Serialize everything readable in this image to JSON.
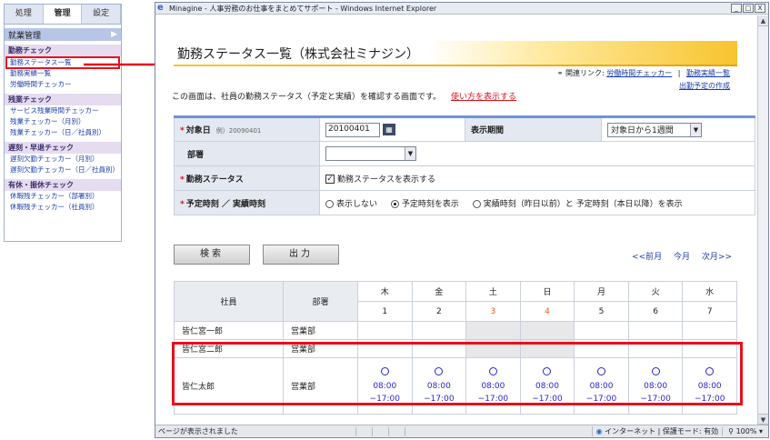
{
  "sidebar": {
    "tabs": [
      "処理",
      "管理",
      "設定"
    ],
    "active_tab": "管理",
    "section_title": "就業管理",
    "groups": [
      {
        "title": "勤務チェック",
        "links": [
          "勤務ステータス一覧",
          "勤務実績一覧",
          "労働時間チェッカー"
        ]
      },
      {
        "title": "残業チェック",
        "links": [
          "サービス残業時間チェッカー",
          "残業チェッカー（月別）",
          "残業チェッカー（日／社員別）"
        ]
      },
      {
        "title": "遅刻・早退チェック",
        "links": [
          "遅刻欠勤チェッカー（月別）",
          "遅刻欠勤チェッカー（日／社員別）"
        ]
      },
      {
        "title": "有休・振休チェック",
        "links": [
          "休暇残チェッカー（部署別）",
          "休暇残チェッカー（社員別）"
        ]
      }
    ]
  },
  "window": {
    "title": "Minagine - 人事労務のお仕事をまとめてサポート - Windows Internet Explorer",
    "min_btn": "_",
    "max_btn": "□",
    "close_btn": "X"
  },
  "page": {
    "title": "勤務ステータス一覧（株式会社ミナジン）",
    "related_label": "関連リンク:",
    "related_links": [
      "労働時間チェッカー",
      "勤務実績一覧",
      "出勤予定の作成"
    ],
    "related_sep": "|",
    "intro": "この画面は、社員の勤務ステータス（予定と実績）を確認する画面です。",
    "usage_link": "使い方を表示する"
  },
  "form": {
    "target_date_label": "対象日",
    "target_date_example": "例）20090401",
    "target_date_value": "20100401",
    "period_label": "表示期間",
    "period_value": "対象日から1週間",
    "dept_label": "部署",
    "dept_value": "",
    "status_label": "勤務ステータス",
    "status_checkbox_label": "勤務ステータスを表示する",
    "time_label": "予定時刻 ／ 実績時刻",
    "time_options": [
      "表示しない",
      "予定時刻を表示",
      "実績時刻（昨日以前）と 予定時刻（本日以降）を表示"
    ],
    "time_selected": 1,
    "req_mark": "*",
    "cal_icon": "▦",
    "dropdown_icon": "▼",
    "check_mark": "✓"
  },
  "buttons": {
    "search": "検索",
    "output": "出力"
  },
  "period_nav": {
    "prev": "<<前月",
    "current": "今月",
    "next": "次月>>"
  },
  "schedule": {
    "col_employee": "社員",
    "col_dept": "部署",
    "days": [
      {
        "weekday": "木",
        "date": "1",
        "weekend": false
      },
      {
        "weekday": "金",
        "date": "2",
        "weekend": false
      },
      {
        "weekday": "土",
        "date": "3",
        "weekend": true
      },
      {
        "weekday": "日",
        "date": "4",
        "weekend": true
      },
      {
        "weekday": "月",
        "date": "5",
        "weekend": false
      },
      {
        "weekday": "火",
        "date": "6",
        "weekend": false
      },
      {
        "weekday": "水",
        "date": "7",
        "weekend": false
      }
    ],
    "rows": [
      {
        "employee": "皆仁宮一郎",
        "dept": "営業部",
        "shifts": null
      },
      {
        "employee": "皆仁宮二郎",
        "dept": "営業部",
        "shifts": null
      },
      {
        "employee": "皆仁太郎",
        "dept": "営業部",
        "shifts": {
          "start": "08:00",
          "end": "−17:00"
        }
      }
    ]
  },
  "status_bar": {
    "text": "ページが表示されました",
    "zone": "インターネット | 保護モード: 有効",
    "zoom": "100%"
  },
  "colors": {
    "accent_red": "#e8101c",
    "link_blue": "#1a3eaa",
    "weekend_orange": "#e85a12"
  }
}
